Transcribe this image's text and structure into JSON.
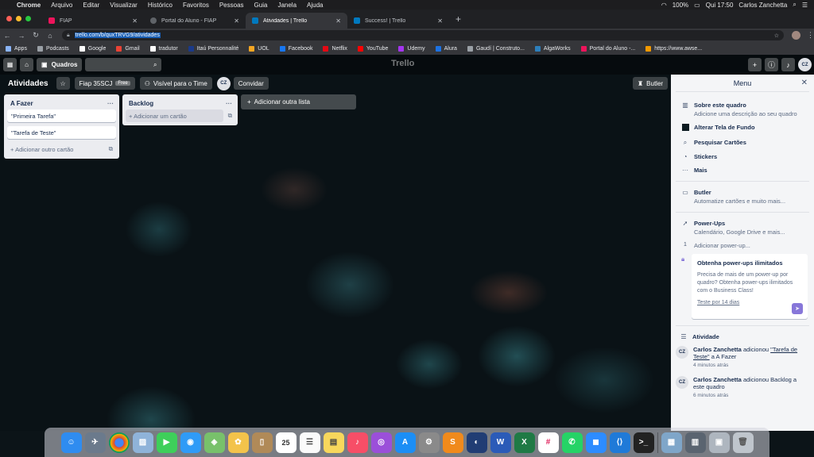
{
  "menubar": {
    "apple": "",
    "items": [
      "Chrome",
      "Arquivo",
      "Editar",
      "Visualizar",
      "Histórico",
      "Favoritos",
      "Pessoas",
      "Guia",
      "Janela",
      "Ajuda"
    ],
    "battery": "100%",
    "clock": "Qui 17:50",
    "user": "Carlos Zanchetta"
  },
  "tabs": [
    {
      "title": "FIAP",
      "color": "#ed145b"
    },
    {
      "title": "Portal do Aluno - FIAP",
      "color": "#5f6368"
    },
    {
      "title": "Atividades | Trello",
      "color": "#0079bf"
    },
    {
      "title": "Success! | Trello",
      "color": "#0079bf"
    }
  ],
  "address": {
    "url": "trello.com/b/quxTRVG9/atividades"
  },
  "bookmarks": [
    {
      "label": "Apps",
      "color": "#8ab4f8"
    },
    {
      "label": "Podcasts",
      "color": "#9aa0a6"
    },
    {
      "label": "Google",
      "color": "#ffffff"
    },
    {
      "label": "Gmail",
      "color": "#ea4335"
    },
    {
      "label": "tradutor",
      "color": "#ffffff"
    },
    {
      "label": "Itaú Personnalité",
      "color": "#1a3a8a"
    },
    {
      "label": "UOL",
      "color": "#f5a623"
    },
    {
      "label": "Facebook",
      "color": "#1877f2"
    },
    {
      "label": "Netflix",
      "color": "#e50914"
    },
    {
      "label": "YouTube",
      "color": "#ff0000"
    },
    {
      "label": "Udemy",
      "color": "#a435f0"
    },
    {
      "label": "Alura",
      "color": "#1c72e3"
    },
    {
      "label": "Gaudí | Construto...",
      "color": "#9aa0a6"
    },
    {
      "label": "AlgaWorks",
      "color": "#2d7fbb"
    },
    {
      "label": "Portal do Aluno -...",
      "color": "#ed145b"
    },
    {
      "label": "https://www.awse...",
      "color": "#f29900"
    }
  ],
  "header": {
    "boards_label": "Quadros",
    "logo": "Trello",
    "avatar": "CZ"
  },
  "board": {
    "title": "Atividades",
    "team": "Fiap 35SCJ",
    "free": "Free",
    "visibility": "Visível para o Time",
    "invite": "Convidar",
    "butler": "Butler"
  },
  "lists": [
    {
      "title": "A Fazer",
      "cards": [
        "\"Primeira Tarefa\"",
        "\"Tarefa de Teste\""
      ],
      "add": "Adicionar outro cartão"
    },
    {
      "title": "Backlog",
      "cards": [],
      "add": "Adicionar um cartão"
    }
  ],
  "add_list": "Adicionar outra lista",
  "menu": {
    "title": "Menu",
    "about_title": "Sobre este quadro",
    "about_sub": "Adicione uma descrição ao seu quadro",
    "background": "Alterar Tela de Fundo",
    "search_cards": "Pesquisar Cartões",
    "stickers": "Stickers",
    "more": "Mais",
    "butler_title": "Butler",
    "butler_sub": "Automatize cartões e muito mais...",
    "powerups_title": "Power-Ups",
    "powerups_sub": "Calendário, Google Drive e mais...",
    "powerup_count": "1",
    "add_powerup": "Adicionar power-up...",
    "promo_title": "Obtenha power-ups ilimitados",
    "promo_desc": "Precisa de mais de um power-up por quadro? Obtenha power-ups ilimitados com o Business Class!",
    "promo_link": "Teste por 14 dias",
    "activity_title": "Atividade",
    "activity": [
      {
        "avatar": "CZ",
        "user": "Carlos Zanchetta",
        "action": "adicionou",
        "target": "\"Tarefa de Teste\"",
        "rest": "a A Fazer",
        "time": "4 minutos atrás"
      },
      {
        "avatar": "CZ",
        "user": "Carlos Zanchetta",
        "action": "adicionou Backlog a este quadro",
        "target": "",
        "rest": "",
        "time": "6 minutos atrás"
      }
    ]
  },
  "dock": {
    "calendar_day": "25"
  }
}
